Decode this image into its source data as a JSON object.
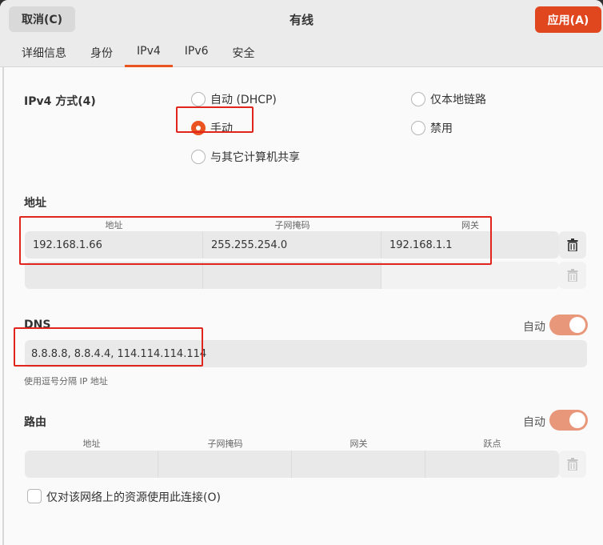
{
  "header": {
    "cancel_label": "取消(C)",
    "title": "有线",
    "apply_label": "应用(A)",
    "tabs": [
      {
        "label": "详细信息",
        "active": false
      },
      {
        "label": "身份",
        "active": false
      },
      {
        "label": "IPv4",
        "active": true
      },
      {
        "label": "IPv6",
        "active": false
      },
      {
        "label": "安全",
        "active": false
      }
    ]
  },
  "method": {
    "label": "IPv4 方式(4)",
    "options": [
      {
        "label": "自动 (DHCP)",
        "selected": false
      },
      {
        "label": "仅本地链路",
        "selected": false
      },
      {
        "label": "手动",
        "selected": true
      },
      {
        "label": "禁用",
        "selected": false
      },
      {
        "label": "与其它计算机共享",
        "selected": false
      }
    ]
  },
  "addresses": {
    "label": "地址",
    "columns": [
      "地址",
      "子网掩码",
      "网关"
    ],
    "rows": [
      [
        "192.168.1.66",
        "255.255.254.0",
        "192.168.1.1"
      ],
      [
        "",
        "",
        ""
      ]
    ]
  },
  "dns": {
    "label": "DNS",
    "auto_label": "自动",
    "auto_on": true,
    "value": "8.8.8.8, 8.8.4.4, 114.114.114.114",
    "hint": "使用逗号分隔 IP 地址"
  },
  "routes": {
    "label": "路由",
    "auto_label": "自动",
    "auto_on": true,
    "columns": [
      "地址",
      "子网掩码",
      "网关",
      "跃点"
    ],
    "rows": [
      [
        "",
        "",
        "",
        ""
      ]
    ]
  },
  "only_local": {
    "label": "仅对该网络上的资源使用此连接(O)",
    "checked": false
  },
  "colors": {
    "accent": "#e95420",
    "apply_button": "#e0471f",
    "toggle_on": "#e8977a",
    "highlight": "#e0261c"
  },
  "icons": [
    "trash-icon"
  ]
}
